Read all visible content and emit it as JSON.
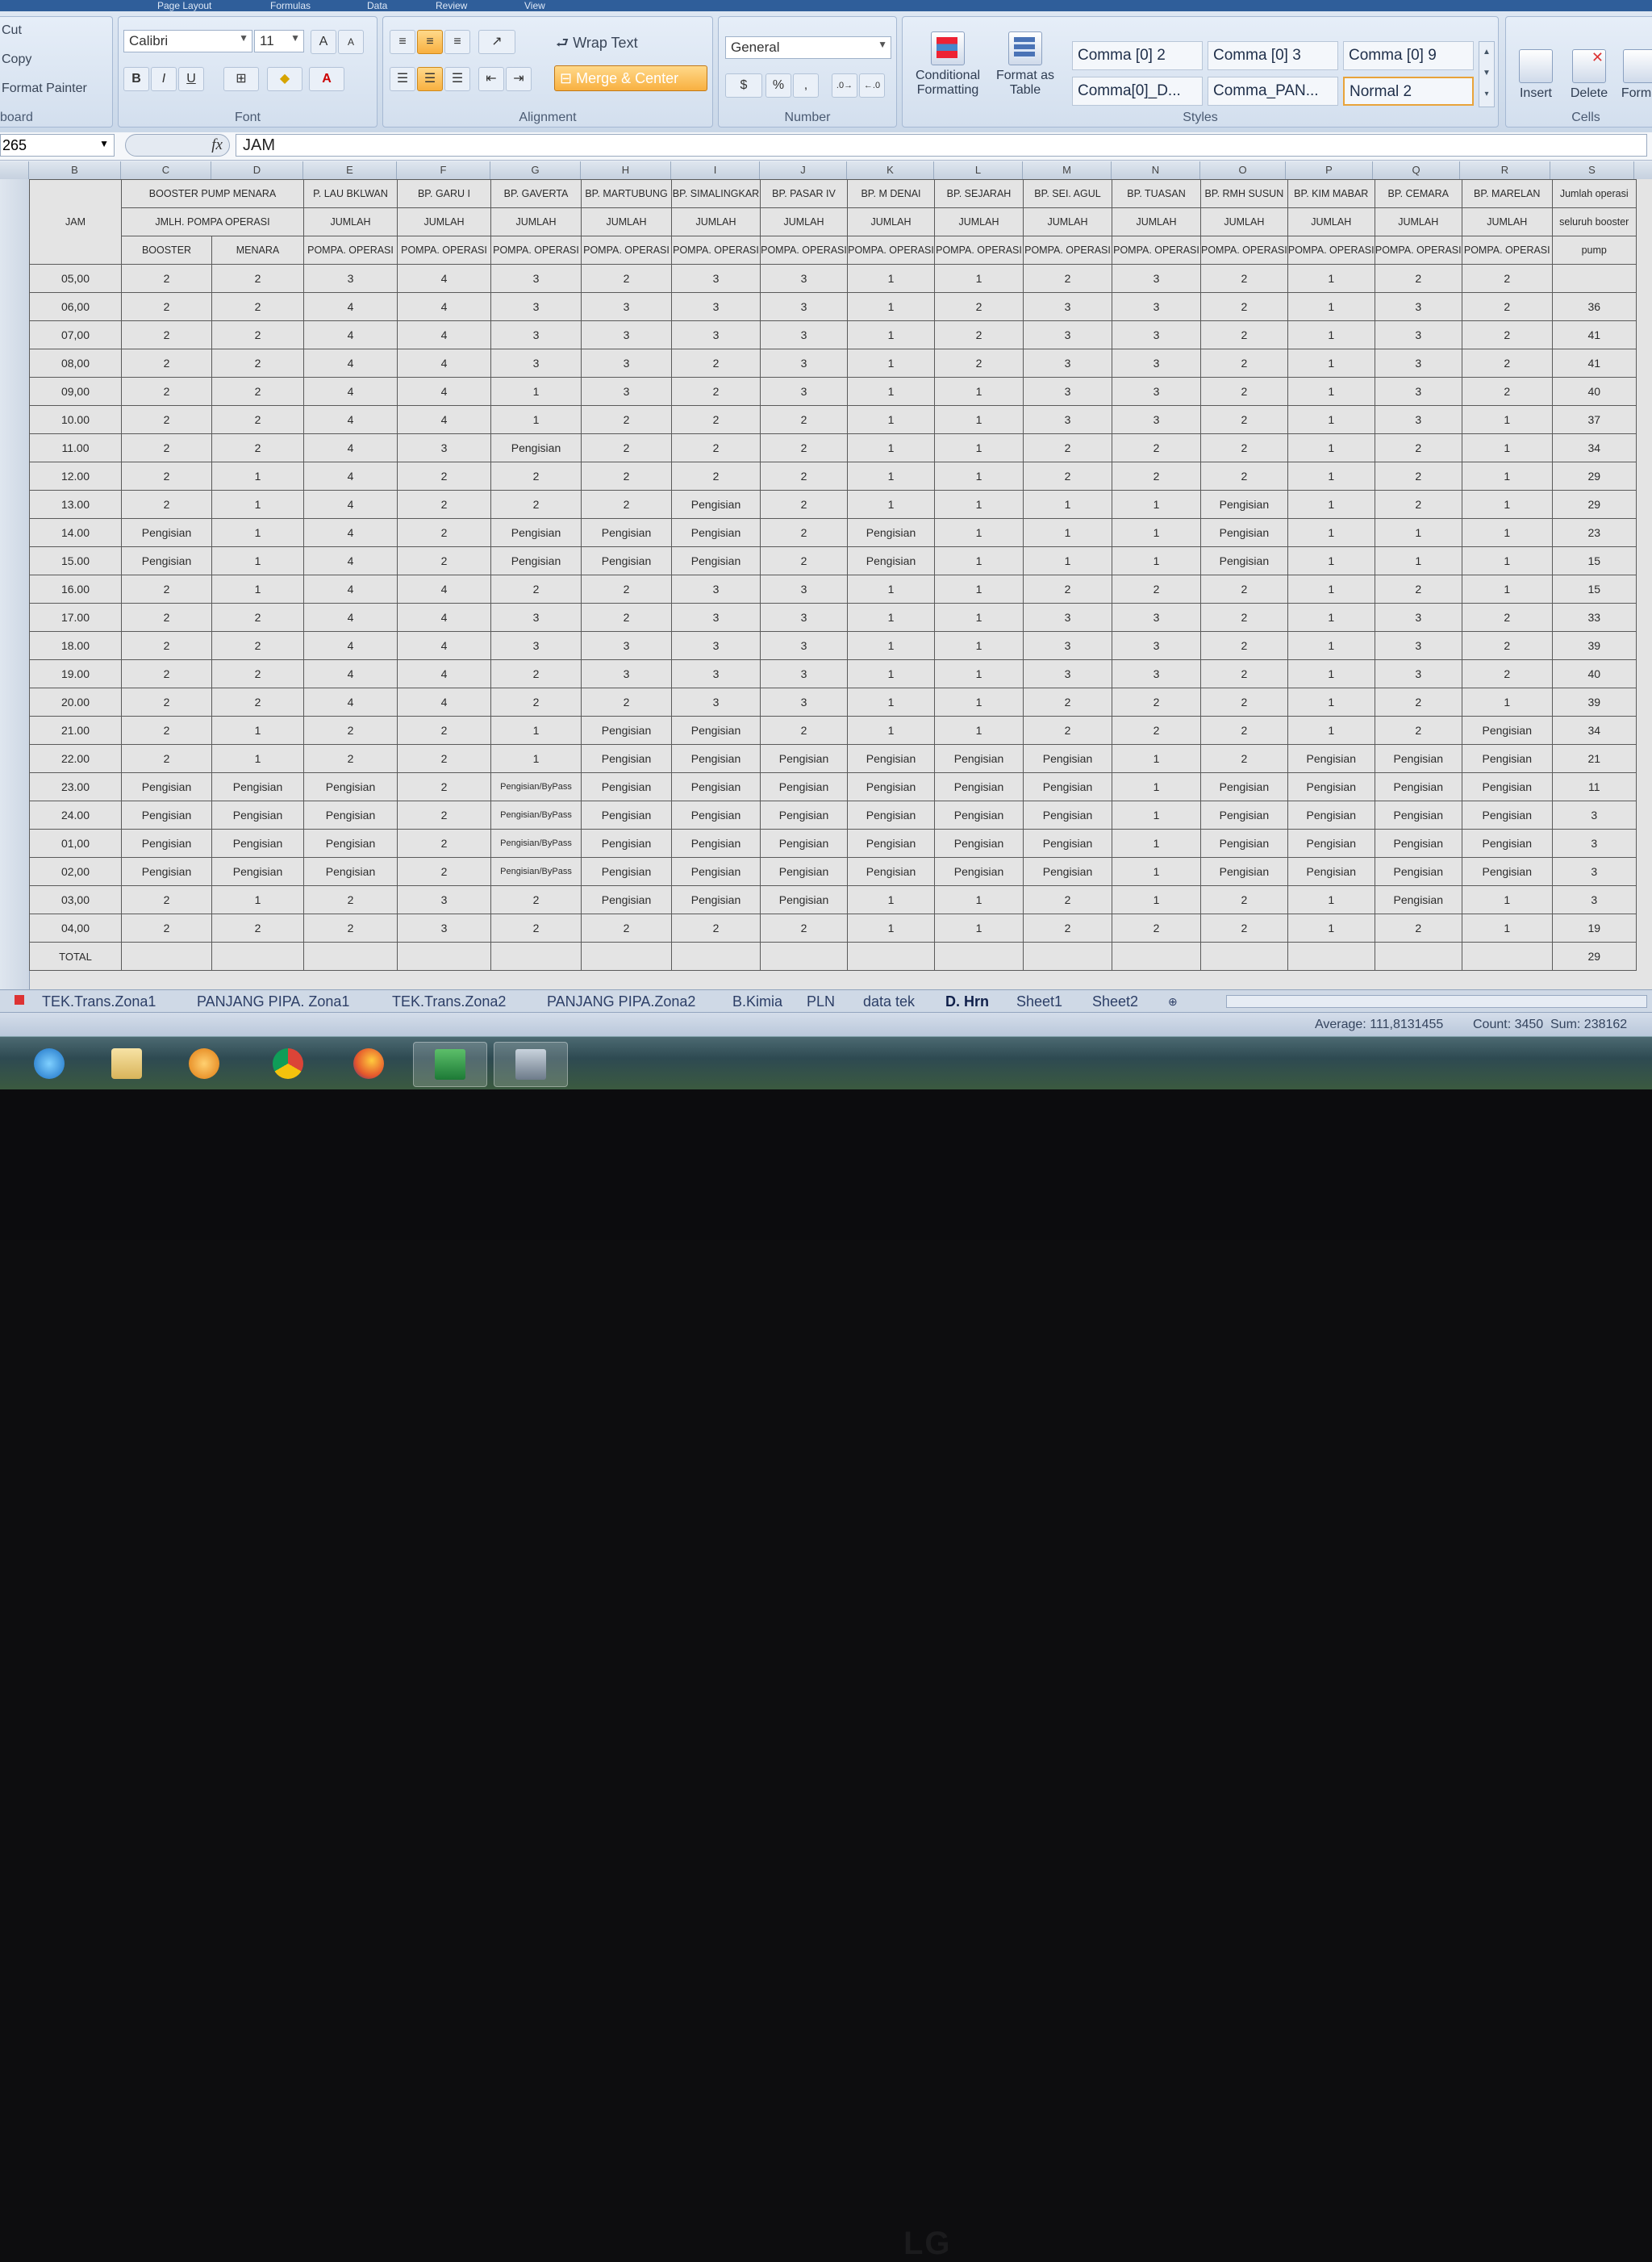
{
  "ribbon": {
    "tabs": [
      "Page Layout",
      "Formulas",
      "Data",
      "Review",
      "View"
    ],
    "clipboard": {
      "cut": "Cut",
      "copy": "Copy",
      "format_painter": "Format Painter",
      "label": "board"
    },
    "font": {
      "name": "Calibri",
      "size": "11",
      "label": "Font"
    },
    "alignment": {
      "wrap_text": "Wrap Text",
      "merge_center": "Merge & Center",
      "label": "Alignment"
    },
    "number": {
      "format": "General",
      "label": "Number"
    },
    "styles": {
      "conditional": "Conditional Formatting",
      "format_table": "Format as Table",
      "cells": [
        "Comma [0] 2",
        "Comma [0] 3",
        "Comma [0] 9",
        "Comma[0]_D...",
        "Comma_PAN...",
        "Normal 2"
      ],
      "label": "Styles"
    },
    "cells": {
      "insert": "Insert",
      "delete": "Delete",
      "format": "Forma",
      "label": "Cells"
    }
  },
  "formula_bar": {
    "name_box": "265",
    "fx": "fx",
    "content": "JAM"
  },
  "columns": [
    "B",
    "C",
    "D",
    "E",
    "F",
    "G",
    "H",
    "I",
    "J",
    "K",
    "L",
    "M",
    "N",
    "O",
    "P",
    "Q",
    "R",
    "S"
  ],
  "header": {
    "jam": "JAM",
    "row1": [
      "BOOSTER PUMP MENARA",
      "P. LAU BKLWAN",
      "BP. GARU I",
      "BP. GAVERTA",
      "BP. MARTUBUNG",
      "BP. SIMALINGKAR",
      "BP. PASAR IV",
      "BP. M DENAI",
      "BP. SEJARAH",
      "BP. SEI. AGUL",
      "BP. TUASAN",
      "BP. RMH SUSUN",
      "BP. KIM MABAR",
      "BP. CEMARA",
      "BP. MARELAN",
      "Jumlah operasi"
    ],
    "row2": [
      "JMLH. POMPA OPERASI",
      "JUMLAH",
      "JUMLAH",
      "JUMLAH",
      "JUMLAH",
      "JUMLAH",
      "JUMLAH",
      "JUMLAH",
      "JUMLAH",
      "JUMLAH",
      "JUMLAH",
      "JUMLAH",
      "JUMLAH",
      "JUMLAH",
      "JUMLAH",
      "seluruh booster"
    ],
    "row3": [
      "BOOSTER",
      "MENARA",
      "POMPA. OPERASI",
      "POMPA. OPERASI",
      "POMPA. OPERASI",
      "POMPA. OPERASI",
      "POMPA. OPERASI",
      "POMPA. OPERASI",
      "POMPA. OPERASI",
      "POMPA. OPERASI",
      "POMPA. OPERASI",
      "POMPA. OPERASI",
      "POMPA. OPERASI",
      "POMPA. OPERASI",
      "POMPA. OPERASI",
      "POMPA. OPERASI",
      "pump"
    ]
  },
  "rows": [
    {
      "jam": "05,00",
      "cells": [
        "2",
        "2",
        "3",
        "4",
        "3",
        "2",
        "3",
        "3",
        "1",
        "1",
        "2",
        "3",
        "2",
        "1",
        "2",
        "2",
        ""
      ]
    },
    {
      "jam": "06,00",
      "cells": [
        "2",
        "2",
        "4",
        "4",
        "3",
        "3",
        "3",
        "3",
        "1",
        "2",
        "3",
        "3",
        "2",
        "1",
        "3",
        "2",
        "36"
      ]
    },
    {
      "jam": "07,00",
      "cells": [
        "2",
        "2",
        "4",
        "4",
        "3",
        "3",
        "3",
        "3",
        "1",
        "2",
        "3",
        "3",
        "2",
        "1",
        "3",
        "2",
        "41"
      ]
    },
    {
      "jam": "08,00",
      "cells": [
        "2",
        "2",
        "4",
        "4",
        "3",
        "3",
        "2",
        "3",
        "1",
        "2",
        "3",
        "3",
        "2",
        "1",
        "3",
        "2",
        "41"
      ]
    },
    {
      "jam": "09,00",
      "cells": [
        "2",
        "2",
        "4",
        "4",
        "1",
        "3",
        "2",
        "3",
        "1",
        "1",
        "3",
        "3",
        "2",
        "1",
        "3",
        "2",
        "40"
      ]
    },
    {
      "jam": "10.00",
      "cells": [
        "2",
        "2",
        "4",
        "4",
        "1",
        "2",
        "2",
        "2",
        "1",
        "1",
        "3",
        "3",
        "2",
        "1",
        "3",
        "1",
        "37"
      ]
    },
    {
      "jam": "11.00",
      "cells": [
        "2",
        "2",
        "4",
        "3",
        "Pengisian",
        "2",
        "2",
        "2",
        "1",
        "1",
        "2",
        "2",
        "2",
        "1",
        "2",
        "1",
        "34"
      ]
    },
    {
      "jam": "12.00",
      "cells": [
        "2",
        "1",
        "4",
        "2",
        "2",
        "2",
        "2",
        "2",
        "1",
        "1",
        "2",
        "2",
        "2",
        "1",
        "2",
        "1",
        "29"
      ]
    },
    {
      "jam": "13.00",
      "cells": [
        "2",
        "1",
        "4",
        "2",
        "2",
        "2",
        "Pengisian",
        "2",
        "1",
        "1",
        "1",
        "1",
        "Pengisian",
        "1",
        "2",
        "1",
        "29"
      ]
    },
    {
      "jam": "14.00",
      "cells": [
        "Pengisian",
        "1",
        "4",
        "2",
        "Pengisian",
        "Pengisian",
        "Pengisian",
        "2",
        "Pengisian",
        "1",
        "1",
        "1",
        "Pengisian",
        "1",
        "1",
        "1",
        "23"
      ]
    },
    {
      "jam": "15.00",
      "cells": [
        "Pengisian",
        "1",
        "4",
        "2",
        "Pengisian",
        "Pengisian",
        "Pengisian",
        "2",
        "Pengisian",
        "1",
        "1",
        "1",
        "Pengisian",
        "1",
        "1",
        "1",
        "15"
      ]
    },
    {
      "jam": "16.00",
      "cells": [
        "2",
        "1",
        "4",
        "4",
        "2",
        "2",
        "3",
        "3",
        "1",
        "1",
        "2",
        "2",
        "2",
        "1",
        "2",
        "1",
        "15"
      ]
    },
    {
      "jam": "17.00",
      "cells": [
        "2",
        "2",
        "4",
        "4",
        "3",
        "2",
        "3",
        "3",
        "1",
        "1",
        "3",
        "3",
        "2",
        "1",
        "3",
        "2",
        "33"
      ]
    },
    {
      "jam": "18.00",
      "cells": [
        "2",
        "2",
        "4",
        "4",
        "3",
        "3",
        "3",
        "3",
        "1",
        "1",
        "3",
        "3",
        "2",
        "1",
        "3",
        "2",
        "39"
      ]
    },
    {
      "jam": "19.00",
      "cells": [
        "2",
        "2",
        "4",
        "4",
        "2",
        "3",
        "3",
        "3",
        "1",
        "1",
        "3",
        "3",
        "2",
        "1",
        "3",
        "2",
        "40"
      ]
    },
    {
      "jam": "20.00",
      "cells": [
        "2",
        "2",
        "4",
        "4",
        "2",
        "2",
        "3",
        "3",
        "1",
        "1",
        "2",
        "2",
        "2",
        "1",
        "2",
        "1",
        "39"
      ]
    },
    {
      "jam": "21.00",
      "cells": [
        "2",
        "1",
        "2",
        "2",
        "1",
        "Pengisian",
        "Pengisian",
        "2",
        "1",
        "1",
        "2",
        "2",
        "2",
        "1",
        "2",
        "Pengisian",
        "34"
      ]
    },
    {
      "jam": "22.00",
      "cells": [
        "2",
        "1",
        "2",
        "2",
        "1",
        "Pengisian",
        "Pengisian",
        "Pengisian",
        "Pengisian",
        "Pengisian",
        "Pengisian",
        "1",
        "2",
        "Pengisian",
        "Pengisian",
        "Pengisian",
        "21"
      ]
    },
    {
      "jam": "23.00",
      "cells": [
        "Pengisian",
        "Pengisian",
        "Pengisian",
        "2",
        "Pengisian/ByPass",
        "Pengisian",
        "Pengisian",
        "Pengisian",
        "Pengisian",
        "Pengisian",
        "Pengisian",
        "1",
        "Pengisian",
        "Pengisian",
        "Pengisian",
        "Pengisian",
        "11"
      ]
    },
    {
      "jam": "24.00",
      "cells": [
        "Pengisian",
        "Pengisian",
        "Pengisian",
        "2",
        "Pengisian/ByPass",
        "Pengisian",
        "Pengisian",
        "Pengisian",
        "Pengisian",
        "Pengisian",
        "Pengisian",
        "1",
        "Pengisian",
        "Pengisian",
        "Pengisian",
        "Pengisian",
        "3"
      ]
    },
    {
      "jam": "01,00",
      "cells": [
        "Pengisian",
        "Pengisian",
        "Pengisian",
        "2",
        "Pengisian/ByPass",
        "Pengisian",
        "Pengisian",
        "Pengisian",
        "Pengisian",
        "Pengisian",
        "Pengisian",
        "1",
        "Pengisian",
        "Pengisian",
        "Pengisian",
        "Pengisian",
        "3"
      ]
    },
    {
      "jam": "02,00",
      "cells": [
        "Pengisian",
        "Pengisian",
        "Pengisian",
        "2",
        "Pengisian/ByPass",
        "Pengisian",
        "Pengisian",
        "Pengisian",
        "Pengisian",
        "Pengisian",
        "Pengisian",
        "1",
        "Pengisian",
        "Pengisian",
        "Pengisian",
        "Pengisian",
        "3"
      ]
    },
    {
      "jam": "03,00",
      "cells": [
        "2",
        "1",
        "2",
        "3",
        "2",
        "Pengisian",
        "Pengisian",
        "Pengisian",
        "1",
        "1",
        "2",
        "1",
        "2",
        "1",
        "Pengisian",
        "1",
        "3"
      ]
    },
    {
      "jam": "04,00",
      "cells": [
        "2",
        "2",
        "2",
        "3",
        "2",
        "2",
        "2",
        "2",
        "1",
        "1",
        "2",
        "2",
        "2",
        "1",
        "2",
        "1",
        "19"
      ]
    }
  ],
  "extra_total": "29",
  "total_label": "TOTAL",
  "sheet_tabs": [
    "TEK.Trans.Zona1",
    "PANJANG PIPA. Zona1",
    "TEK.Trans.Zona2",
    "PANJANG PIPA.Zona2",
    "B.Kimia",
    "PLN",
    "data tek",
    "D. Hrn",
    "Sheet1",
    "Sheet2"
  ],
  "active_tab": "D. Hrn",
  "status": {
    "average": "Average: 111,8131455",
    "count": "Count: 3450",
    "sum": "Sum: 238162"
  },
  "taskbar": [
    "internet-explorer-icon",
    "folder-icon",
    "media-player-icon",
    "chrome-icon",
    "firefox-icon",
    "excel-icon",
    "network-icon"
  ],
  "monitor_brand": "LG"
}
